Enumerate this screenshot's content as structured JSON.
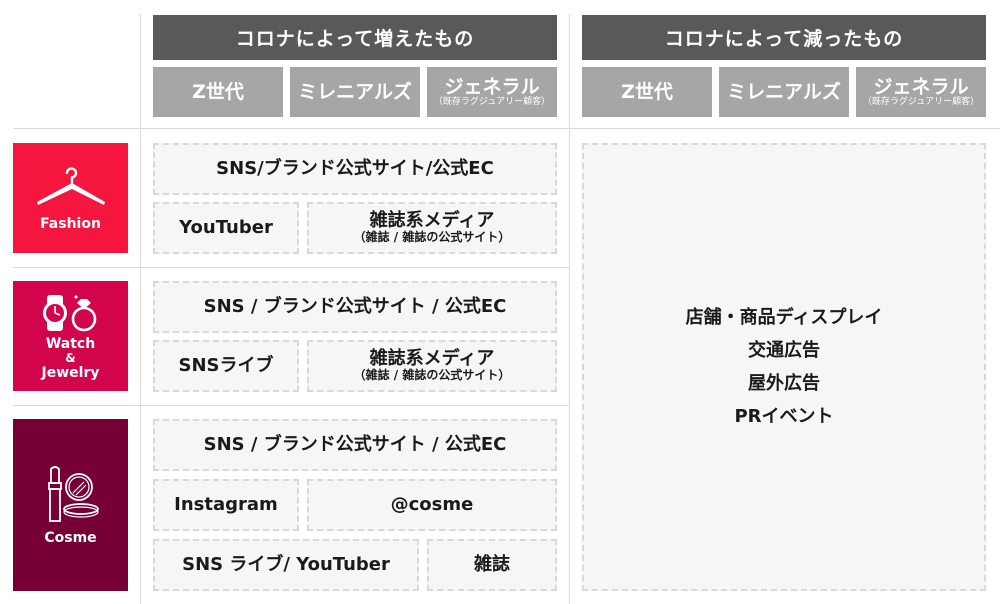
{
  "headers": {
    "increased": {
      "title": "コロナによって増えたもの",
      "segments": [
        {
          "label": "Z世代",
          "sub": ""
        },
        {
          "label": "ミレニアルズ",
          "sub": ""
        },
        {
          "label": "ジェネラル",
          "sub": "（既存ラグジュアリー顧客）"
        }
      ]
    },
    "decreased": {
      "title": "コロナによって減ったもの",
      "segments": [
        {
          "label": "Z世代",
          "sub": ""
        },
        {
          "label": "ミレニアルズ",
          "sub": ""
        },
        {
          "label": "ジェネラル",
          "sub": "（既存ラグジュアリー顧客）"
        }
      ]
    }
  },
  "colors": {
    "header_dark": "#595959",
    "header_light": "#a6a6a6",
    "fashion": "#f5163f",
    "watch_jewelry": "#d2054c",
    "cosme": "#760036",
    "box_bg": "#f6f6f6",
    "box_border": "#d9d9d9"
  },
  "categories": [
    {
      "name": "Fashion",
      "icon": "hanger-icon",
      "increased": {
        "row1": "SNS/ブランド公式サイト/公式EC",
        "row2": [
          {
            "label": "YouTuber",
            "sub": ""
          },
          {
            "label": "雑誌系メディア",
            "sub": "（雑誌 / 雑誌の公式サイト）"
          }
        ]
      }
    },
    {
      "name_lines": [
        "Watch",
        "&",
        "Jewelry"
      ],
      "icon": "watch-ring-icon",
      "increased": {
        "row1": "SNS / ブランド公式サイト / 公式EC",
        "row2": [
          {
            "label": "SNSライブ",
            "sub": ""
          },
          {
            "label": "雑誌系メディア",
            "sub": "（雑誌 / 雑誌の公式サイト）"
          }
        ]
      }
    },
    {
      "name": "Cosme",
      "icon": "lipstick-compact-icon",
      "increased": {
        "row1": "SNS / ブランド公式サイト / 公式EC",
        "row2": [
          {
            "label": "Instagram"
          },
          {
            "label": "@cosme"
          }
        ],
        "row3": [
          {
            "label": "SNS ライブ/ YouTuber"
          },
          {
            "label": "雑誌"
          }
        ]
      }
    }
  ],
  "decreased_all": [
    "店舗・商品ディスプレイ",
    "交通広告",
    "屋外広告",
    "PRイベント"
  ]
}
